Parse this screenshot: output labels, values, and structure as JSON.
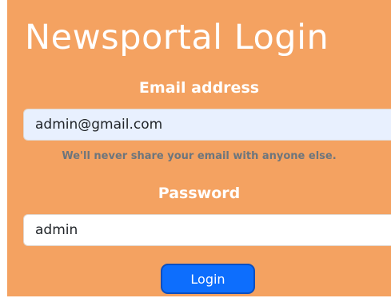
{
  "page": {
    "title": "Newsportal Login"
  },
  "form": {
    "email_label": "Email address",
    "email_value": "admin@gmail.com",
    "email_help": "We'll never share your email with anyone else.",
    "password_label": "Password",
    "password_value": "admin",
    "login_label": "Login"
  },
  "colors": {
    "panel_background": "#f4a261",
    "button_primary": "#0d6efd",
    "autofill_background": "#e8f0fe"
  }
}
